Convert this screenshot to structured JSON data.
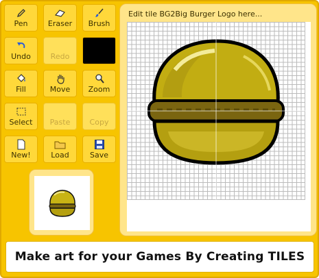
{
  "toolbar": {
    "pen_label": "Pen",
    "eraser_label": "Eraser",
    "brush_label": "Brush",
    "undo_label": "Undo",
    "redo_label": "Redo",
    "fill_label": "Fill",
    "move_label": "Move",
    "zoom_label": "Zoom",
    "select_label": "Select",
    "paste_label": "Paste",
    "copy_label": "Copy",
    "new_label": "New!",
    "load_label": "Load",
    "save_label": "Save"
  },
  "current_color": "#000000",
  "editor": {
    "title": "Edit tile BG2Big Burger Logo here..."
  },
  "banner": {
    "text": "Make art for your Games By Creating TILES"
  },
  "colors": {
    "panel_yellow": "#f7c400",
    "button_yellow": "#ffd83a",
    "card_yellow": "#ffe58a",
    "bun": "#c8b414",
    "patty": "#7a6510"
  },
  "icons": {
    "pen": "pencil-icon",
    "eraser": "eraser-icon",
    "brush": "brush-icon",
    "undo": "undo-arrow-icon",
    "fill": "paint-bucket-icon",
    "move": "hand-icon",
    "zoom": "magnifier-icon",
    "select": "marquee-icon",
    "new": "new-page-icon",
    "load": "folder-icon",
    "save": "floppy-disk-icon"
  }
}
